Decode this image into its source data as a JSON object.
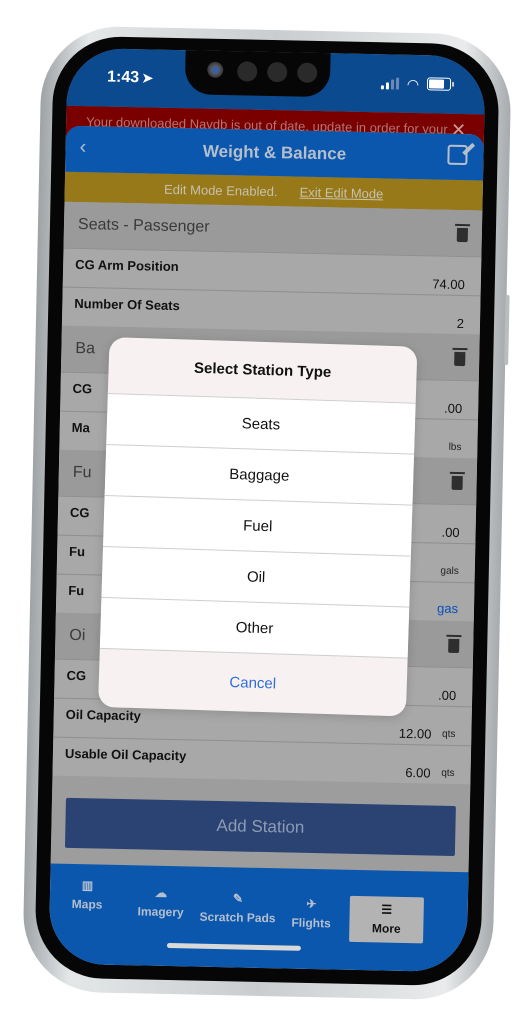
{
  "status_bar": {
    "time": "1:43",
    "location_icon": "location-arrow-icon",
    "signal_icon": "signal-icon",
    "wifi_icon": "wifi-icon",
    "battery_icon": "battery-icon"
  },
  "banner": {
    "text": "Your downloaded Navdb is out of date, update in order for your",
    "close_icon": "close-icon"
  },
  "header": {
    "title": "Weight & Balance",
    "back_icon": "chevron-left-icon",
    "edit_icon": "edit-icon"
  },
  "edit_bar": {
    "message": "Edit Mode Enabled.",
    "exit_label": "Exit Edit Mode"
  },
  "sections": [
    {
      "title": "Seats - Passenger",
      "rows": [
        {
          "label": "CG Arm Position",
          "value": "74.00",
          "unit": ""
        },
        {
          "label": "Number Of Seats",
          "value": "2",
          "unit": ""
        }
      ]
    },
    {
      "title": "Ba",
      "rows": [
        {
          "label": "CG",
          "value": ".00",
          "unit": ""
        },
        {
          "label": "Ma",
          "value": "",
          "unit": "lbs"
        }
      ]
    },
    {
      "title": "Fu",
      "rows": [
        {
          "label": "CG",
          "value": ".00",
          "unit": ""
        },
        {
          "label": "Fu",
          "value": "",
          "unit": "gals"
        },
        {
          "label": "Fu",
          "value": "",
          "unit": "gas"
        }
      ]
    },
    {
      "title": "Oi",
      "rows": [
        {
          "label": "CG",
          "value": ".00",
          "unit": ""
        },
        {
          "label": "Oil Capacity",
          "value": "12.00",
          "unit": "qts"
        },
        {
          "label": "Usable Oil Capacity",
          "value": "6.00",
          "unit": "qts"
        }
      ]
    }
  ],
  "add_station_label": "Add Station",
  "dialog": {
    "title": "Select Station Type",
    "options": [
      "Seats",
      "Baggage",
      "Fuel",
      "Oil",
      "Other"
    ],
    "cancel_label": "Cancel"
  },
  "tabs": [
    {
      "label": "Maps",
      "icon": "map-icon"
    },
    {
      "label": "Imagery",
      "icon": "weather-icon"
    },
    {
      "label": "Scratch Pads",
      "icon": "scratchpad-icon"
    },
    {
      "label": "Flights",
      "icon": "plane-departure-icon"
    },
    {
      "label": "More",
      "icon": "menu-icon"
    }
  ]
}
